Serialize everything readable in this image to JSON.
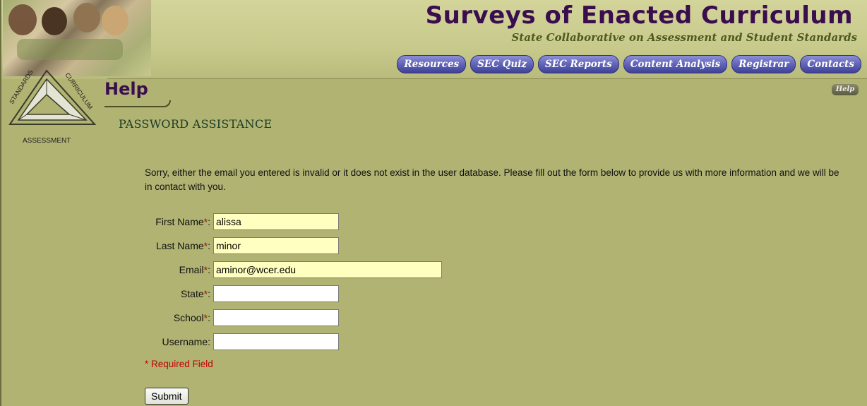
{
  "site": {
    "title": "Surveys of Enacted Curriculum",
    "subtitle": "State Collaborative on Assessment and Student Standards"
  },
  "nav": {
    "items": [
      {
        "label": "Resources"
      },
      {
        "label": "SEC Quiz"
      },
      {
        "label": "SEC Reports"
      },
      {
        "label": "Content Analysis"
      },
      {
        "label": "Registrar"
      },
      {
        "label": "Contacts"
      }
    ]
  },
  "logo": {
    "left_text": "STANDARDS",
    "right_text": "CURRICULUM",
    "bottom_text": "ASSESSMENT"
  },
  "page": {
    "heading": "Help",
    "help_badge": "Help",
    "section_title": "PASSWORD ASSISTANCE",
    "message": "Sorry, either the email you entered is invalid or it does not exist in the user database. Please fill out the form below to provide us with more information and we will be in contact with you."
  },
  "form": {
    "first_name": {
      "label": "First Name",
      "value": "alissa"
    },
    "last_name": {
      "label": "Last Name",
      "value": "minor"
    },
    "email": {
      "label": "Email",
      "value": "aminor@wcer.edu"
    },
    "state": {
      "label": "State",
      "value": ""
    },
    "school": {
      "label": "School",
      "value": ""
    },
    "username": {
      "label": "Username:",
      "value": ""
    },
    "required_marker": "*",
    "colon": ":",
    "required_note": "* Required Field",
    "submit_label": "Submit"
  },
  "colors": {
    "background": "#b0b372",
    "title": "#3a0e4e",
    "nav_button": "#5d60b4",
    "required": "#c00000",
    "filled_input": "#ffffc0"
  }
}
